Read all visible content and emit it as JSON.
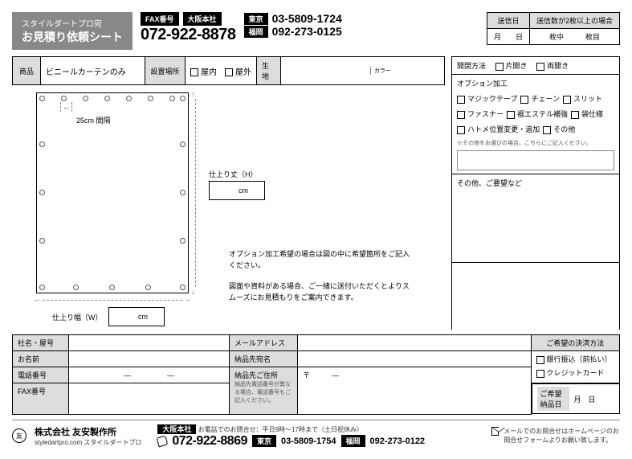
{
  "header": {
    "subtitle": "スタイルダートプロ宛",
    "title": "お見積り依頼シート",
    "fax_label": "FAX番号",
    "osaka_label": "大阪本社",
    "osaka_fax": "072-922-8878",
    "tokyo_label": "東京",
    "tokyo_num": "03-5809-1724",
    "fukuoka_label": "福岡",
    "fukuoka_num": "092-273-0125",
    "send_date_label": "送信日",
    "send_date_value": "月　　日",
    "multi_label": "送信数が2枚以上の場合",
    "multi_value": "枚中　　　枚目"
  },
  "spec": {
    "product_label": "商品",
    "product_value": "ビニールカーテンのみ",
    "place_label": "設置場所",
    "indoor": "屋内",
    "outdoor": "屋外",
    "fabric_label": "生地",
    "color_label": "カラー",
    "open_label": "開閉方法",
    "open_single": "片開き",
    "open_double": "両開き"
  },
  "options": {
    "title": "オプション加工",
    "items": [
      "マジックテープ",
      "チェーン",
      "スリット",
      "ファスナー",
      "裾エステル補強",
      "袋仕様",
      "ハトメ位置変更・追加",
      "その他"
    ],
    "note": "※その他をお選びの場合、こちらにご記入ください。",
    "other_label": "その他、ご要望など"
  },
  "diagram": {
    "spacing": "25cm 間隔",
    "height_label": "仕上り丈（H）",
    "width_label": "仕上り幅（W）",
    "unit": "cm",
    "note1": "オプション加工希望の場合は図の中に希望箇所をご記入ください。",
    "note2": "図面や資料がある場合、ご一緒に送付いただくとよりスムーズにお見積もりをご案内できます。"
  },
  "bottom": {
    "company": "社名・屋号",
    "name": "お名前",
    "tel": "電話番号",
    "tel_value": "―　　　　　―",
    "fax": "FAX番号",
    "email": "メールアドレス",
    "ship_name": "納品先宛名",
    "ship_addr": "納品先ご住所",
    "ship_addr_note": "納品先電話番号が異なる場合、電話番号もご記入ください。",
    "postal": "〒　　　―",
    "pay_label": "ご希望の決済方法",
    "pay_bank": "銀行振込（前払い）",
    "pay_card": "クレジットカード",
    "deliver_label": "ご希望納品日",
    "deliver_value": "月　日"
  },
  "footer": {
    "company": "株式会社 友安製作所",
    "brand": "styledartpro.com スタイルダートプロ",
    "osaka_label": "大阪本社",
    "contact_note": "お電話でのお問合せ：平日9時～17時まで（土日祝休み）",
    "osaka_tel": "072-922-8869",
    "tokyo_label": "東京",
    "tokyo_tel": "03-5809-1754",
    "fukuoka_label": "福岡",
    "fukuoka_tel": "092-273-0122",
    "mail_note": "メールでのお問合せはホームページのお問合せフォームよりお願い致します。"
  }
}
